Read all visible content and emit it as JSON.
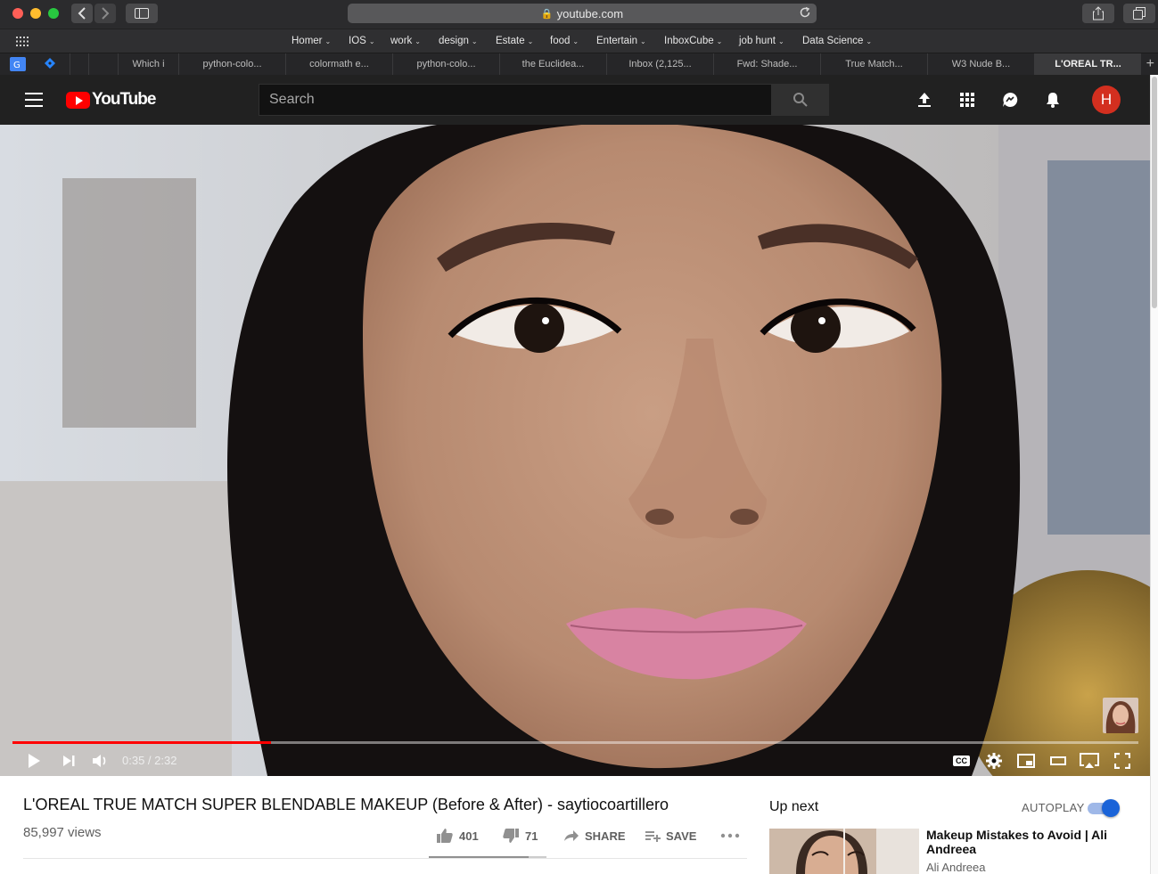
{
  "browser": {
    "url": "youtube.com",
    "bookmarks": [
      {
        "label": "Homer"
      },
      {
        "label": "IOS"
      },
      {
        "label": "work"
      },
      {
        "label": "design"
      },
      {
        "label": "Estate"
      },
      {
        "label": "food"
      },
      {
        "label": "Entertain"
      },
      {
        "label": "InboxCube"
      },
      {
        "label": "job hunt"
      },
      {
        "label": "Data Science"
      }
    ],
    "tabs": [
      {
        "label": "Which i"
      },
      {
        "label": "python-colo..."
      },
      {
        "label": "colormath e..."
      },
      {
        "label": "python-colo..."
      },
      {
        "label": "the Euclidea..."
      },
      {
        "label": "Inbox (2,125..."
      },
      {
        "label": "Fwd: Shade..."
      },
      {
        "label": "True Match..."
      },
      {
        "label": "W3 Nude B..."
      },
      {
        "label": "L'OREAL TR..."
      }
    ],
    "new_tab": "+"
  },
  "youtube": {
    "logo_text": "YouTube",
    "search_placeholder": "Search",
    "avatar_initial": "H",
    "player": {
      "current_time": "0:35",
      "duration": "2:32",
      "time_display": "0:35 / 2:32",
      "progress_fraction": 0.23,
      "cc_label": "CC"
    },
    "video": {
      "title": "L'OREAL TRUE MATCH SUPER BLENDABLE MAKEUP (Before & After) - saytiocoartillero",
      "views": "85,997 views",
      "likes": "401",
      "dislikes": "71",
      "share_label": "SHARE",
      "save_label": "SAVE",
      "like_fraction": 0.85
    },
    "sidebar": {
      "up_next_label": "Up next",
      "autoplay_label": "AUTOPLAY",
      "autoplay_on": true,
      "recommendation": {
        "title": "Makeup Mistakes to Avoid | Ali Andreea",
        "channel": "Ali Andreea"
      }
    }
  },
  "colors": {
    "brand_red": "#ff0000",
    "header_bg": "#212121",
    "avatar_bg": "#d32f1f",
    "toggle_blue": "#1a63d8"
  }
}
